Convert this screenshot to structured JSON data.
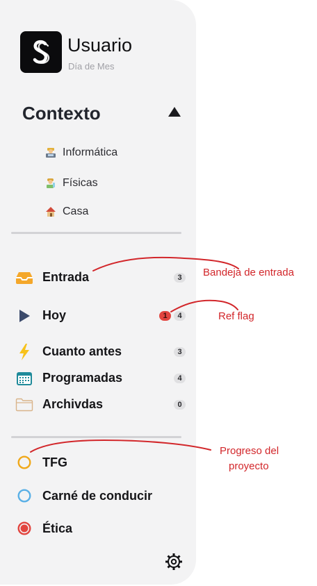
{
  "user": {
    "name": "Usuario",
    "subtitle": "Día de Mes",
    "logo_icon": "s-loop-logo-icon"
  },
  "context": {
    "title": "Contexto",
    "toggle_icon": "triangle-up-icon",
    "items": [
      {
        "label": "Informática",
        "icon": "computer-worker-emoji-icon"
      },
      {
        "label": "Físicas",
        "icon": "scientist-emoji-icon"
      },
      {
        "label": "Casa",
        "icon": "house-emoji-icon"
      }
    ]
  },
  "nav": [
    {
      "label": "Entrada",
      "icon": "inbox-tray-icon",
      "count": "3"
    },
    {
      "label": "Hoy",
      "icon": "play-triangle-icon",
      "flag": "1",
      "count": "4"
    },
    {
      "label": "Cuanto antes",
      "icon": "lightning-icon",
      "count": "3"
    },
    {
      "label": "Programadas",
      "icon": "calendar-icon",
      "count": "4"
    },
    {
      "label": "Archivdas",
      "icon": "folder-icon",
      "count": "0"
    }
  ],
  "projects": [
    {
      "label": "TFG",
      "color": "#f0a81a",
      "style": "ring"
    },
    {
      "label": "Carné de conducir",
      "color": "#5ab0e6",
      "style": "ring"
    },
    {
      "label": "Ética",
      "color": "#e2453f",
      "style": "dot"
    }
  ],
  "settings_icon": "gear-icon",
  "annotations": {
    "inbox": "Bandeja de entrada",
    "flag": "Ref flag",
    "progress_line1": "Progreso del",
    "progress_line2": "proyecto"
  },
  "colors": {
    "annotation": "#d2262a",
    "panel": "#f3f3f4",
    "flag": "#e2453f"
  }
}
